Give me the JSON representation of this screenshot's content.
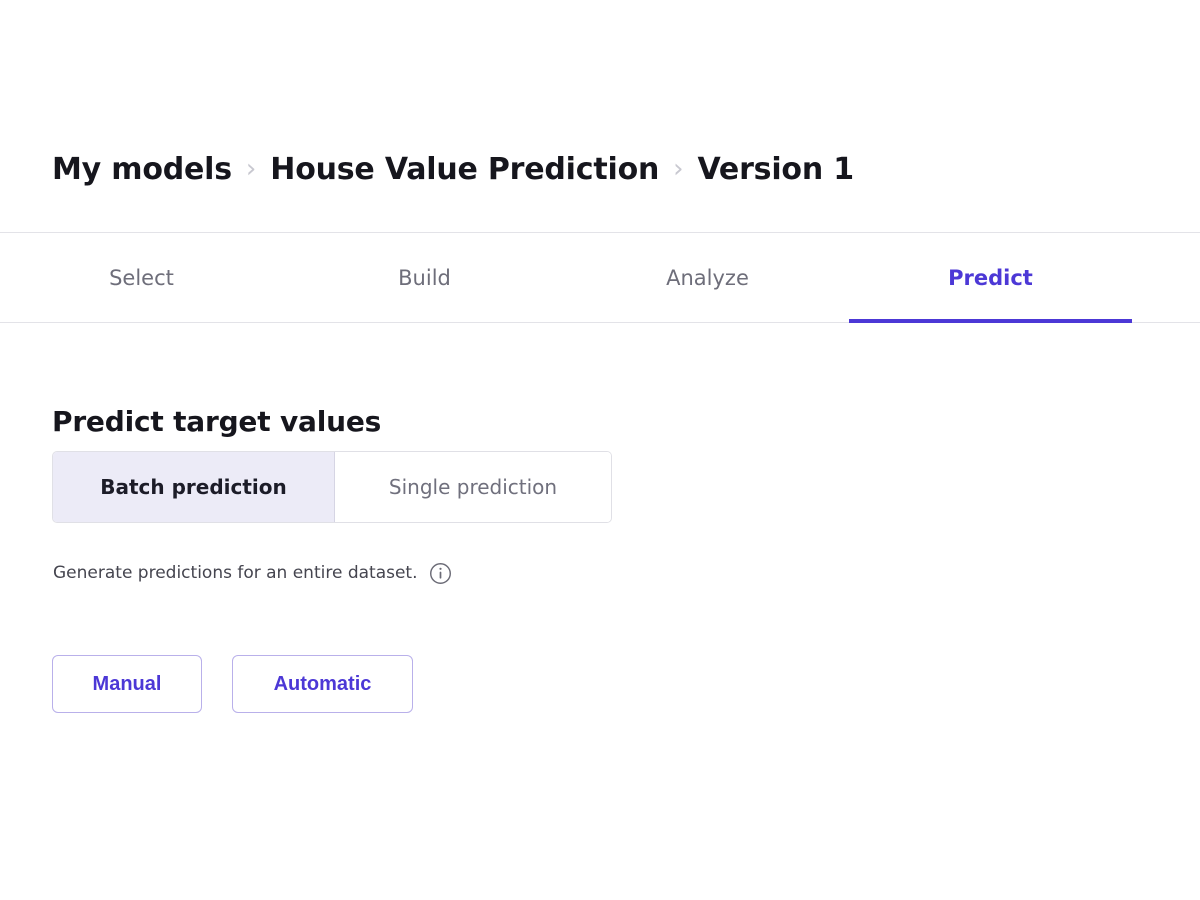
{
  "breadcrumb": {
    "separator": "›",
    "items": [
      {
        "label": "My models"
      },
      {
        "label": "House Value Prediction"
      },
      {
        "label": "Version 1"
      }
    ]
  },
  "tabs": [
    {
      "label": "Select",
      "active": false
    },
    {
      "label": "Build",
      "active": false
    },
    {
      "label": "Analyze",
      "active": false
    },
    {
      "label": "Predict",
      "active": true
    }
  ],
  "main": {
    "section_title": "Predict target values",
    "mode_toggle": {
      "batch_label": "Batch prediction",
      "single_label": "Single prediction",
      "selected": "Batch prediction"
    },
    "description": {
      "text": "Generate predictions for an entire dataset.",
      "info_icon": "info-circle-icon"
    },
    "actions": [
      {
        "label": "Manual"
      },
      {
        "label": "Automatic"
      }
    ]
  },
  "colors": {
    "accent": "#4c38d6",
    "accent_soft": "#ecebf7",
    "accent_border": "#b9b0ea",
    "text_primary": "#16161d",
    "text_muted": "#6e6e7a",
    "border": "#e3e3e8"
  }
}
